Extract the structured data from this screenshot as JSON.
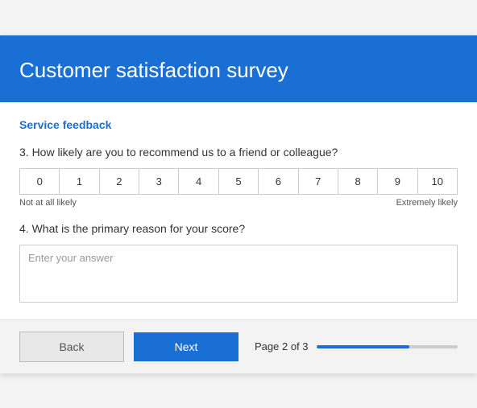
{
  "header": {
    "title": "Customer satisfaction survey"
  },
  "section": {
    "title": "Service feedback"
  },
  "questions": {
    "q3": {
      "label": "3. How likely are you to recommend us to a friend or colleague?",
      "scale": [
        "0",
        "1",
        "2",
        "3",
        "4",
        "5",
        "6",
        "7",
        "8",
        "9",
        "10"
      ],
      "label_low": "Not at all likely",
      "label_high": "Extremely likely"
    },
    "q4": {
      "label": "4. What is the primary reason for your score?",
      "placeholder": "Enter your answer"
    }
  },
  "footer": {
    "back_label": "Back",
    "next_label": "Next",
    "page_label": "Page 2 of 3",
    "progress_percent": 66
  }
}
